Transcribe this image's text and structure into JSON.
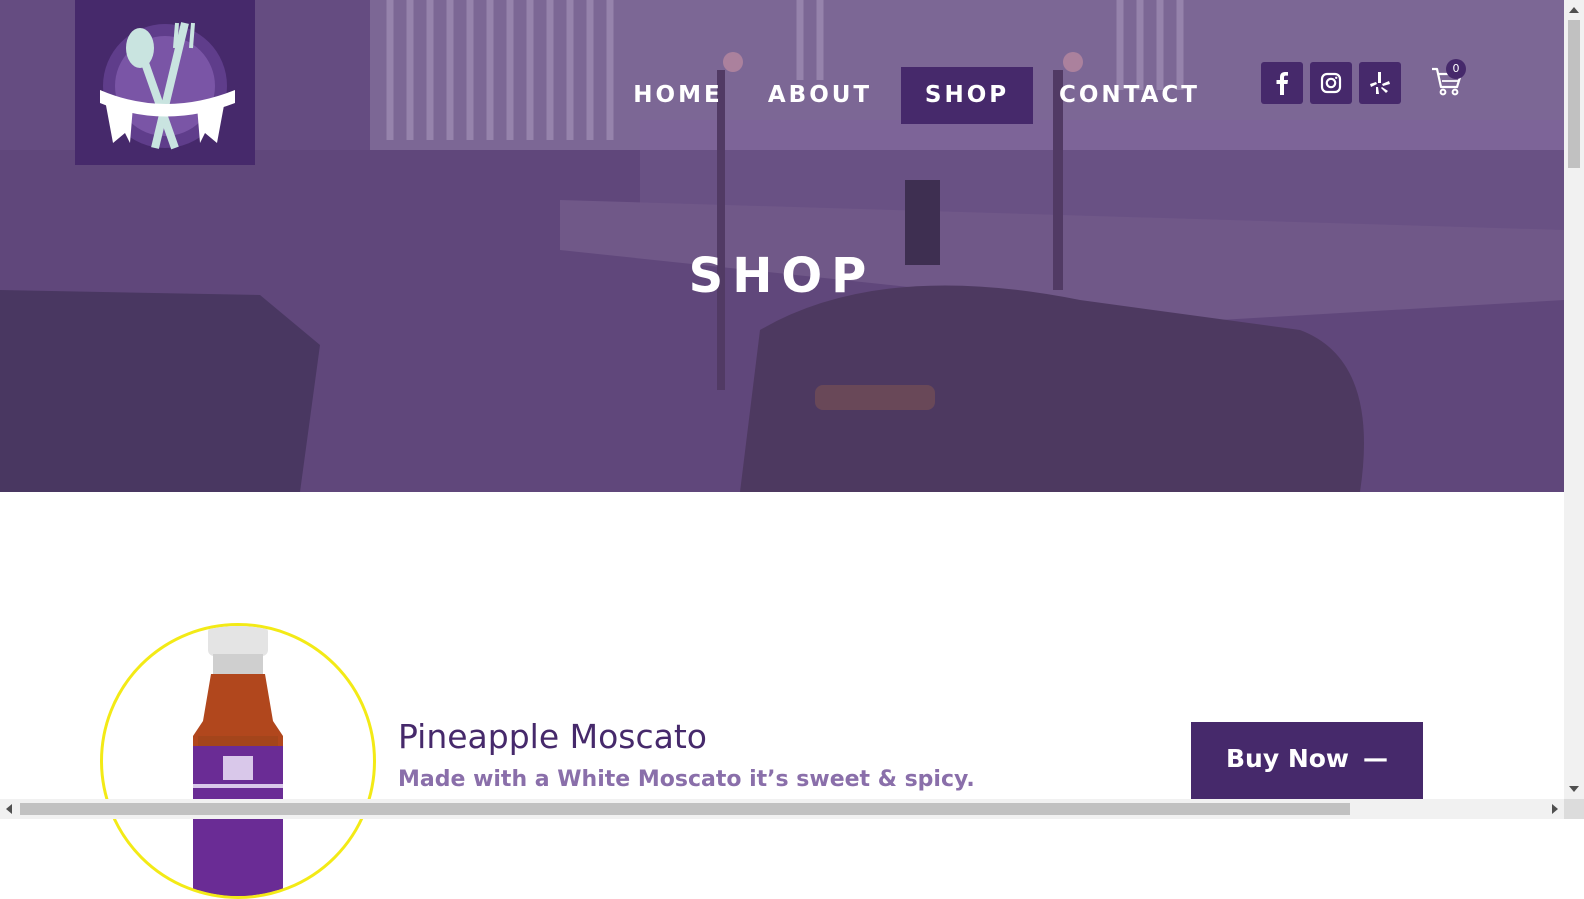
{
  "nav": {
    "items": [
      {
        "label": "HOME",
        "active": false
      },
      {
        "label": "ABOUT",
        "active": false
      },
      {
        "label": "SHOP",
        "active": true
      },
      {
        "label": "CONTACT",
        "active": false
      }
    ]
  },
  "social": [
    "facebook-icon",
    "instagram-icon",
    "yelp-icon"
  ],
  "cart": {
    "count": "0"
  },
  "hero": {
    "title": "SHOP"
  },
  "product": {
    "name": "Pineapple Moscato",
    "description": "Made with a White Moscato it’s sweet & spicy.",
    "buy_label": "Buy Now",
    "buy_dash": "—"
  },
  "colors": {
    "brand": "#46296b",
    "accent": "#f3ea16",
    "desc": "#8a6faa"
  }
}
